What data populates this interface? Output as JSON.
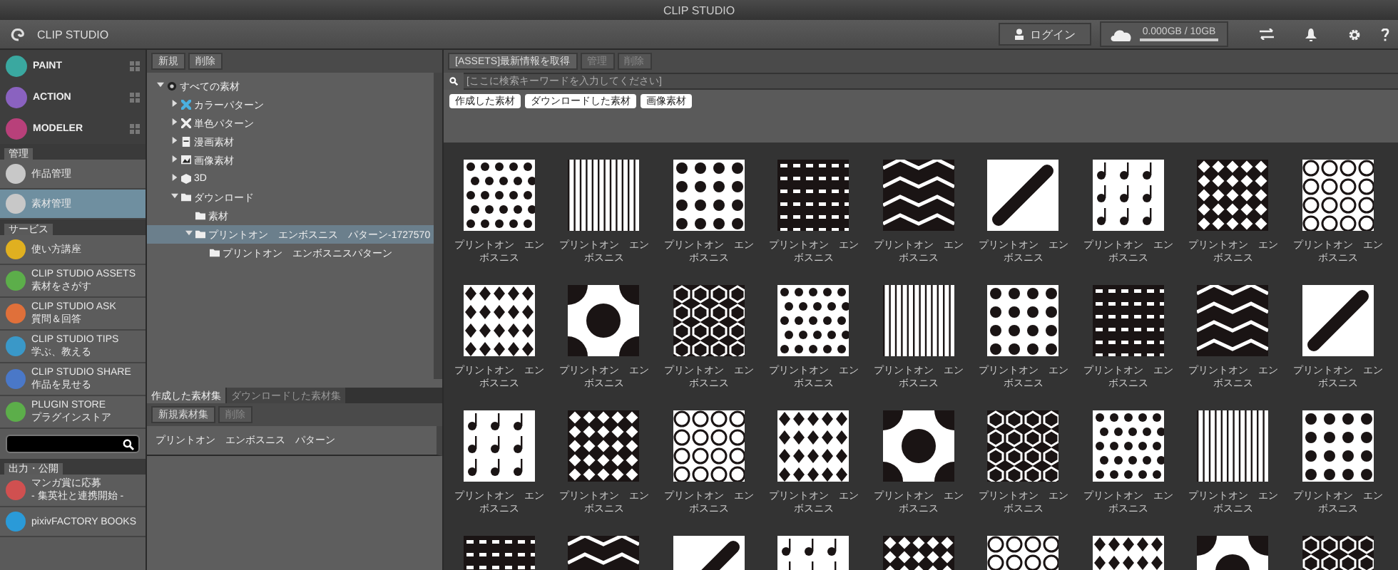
{
  "window": {
    "title": "CLIP STUDIO"
  },
  "header": {
    "app_name": "CLIP STUDIO",
    "login": "ログイン",
    "storage": {
      "reading": "0.000GB / 10GB",
      "level": 0
    }
  },
  "sidebar": {
    "apps": [
      {
        "label": "PAINT",
        "color": "#3aa8a0"
      },
      {
        "label": "ACTION",
        "color": "#8a62c0"
      },
      {
        "label": "MODELER",
        "color": "#b8407a"
      }
    ],
    "sections": [
      {
        "title": "管理",
        "items": [
          {
            "label": "作品管理",
            "selected": false,
            "color": "#c8c8c8"
          },
          {
            "label": "素材管理",
            "selected": true,
            "color": "#c8c8c8"
          }
        ]
      },
      {
        "title": "サービス",
        "items": [
          {
            "label": "使い方講座",
            "selected": false,
            "color": "#e0b020"
          },
          {
            "label": "CLIP STUDIO ASSETS",
            "sub": "素材をさがす",
            "selected": false,
            "color": "#5cae4a"
          },
          {
            "label": "CLIP STUDIO ASK",
            "sub": "質問＆回答",
            "selected": false,
            "color": "#e0703a"
          },
          {
            "label": "CLIP STUDIO TIPS",
            "sub": "学ぶ、教える",
            "selected": false,
            "color": "#3a98c8"
          },
          {
            "label": "CLIP STUDIO SHARE",
            "sub": "作品を見せる",
            "selected": false,
            "color": "#4a78c8"
          },
          {
            "label": "PLUGIN STORE",
            "sub": "プラグインストア",
            "selected": false,
            "color": "#5cae4a"
          }
        ]
      },
      {
        "title": "出力・公開",
        "search": true,
        "items": [
          {
            "label": "マンガ賞に応募",
            "sub": "- 集英社と連携開始 -",
            "selected": false,
            "color": "#d05050"
          },
          {
            "label": "pixivFACTORY BOOKS",
            "selected": false,
            "color": "#2a9ad8"
          }
        ]
      }
    ]
  },
  "tree": {
    "buttons": [
      {
        "label": "新規",
        "disabled": false
      },
      {
        "label": "削除",
        "disabled": false
      }
    ],
    "items": [
      {
        "label": "すべての素材",
        "kind": "root",
        "expanded": true,
        "selected": false,
        "children": [
          {
            "label": "カラーパターン",
            "kind": "color",
            "expanded": false,
            "selected": false
          },
          {
            "label": "単色パターン",
            "kind": "mono",
            "expanded": false,
            "selected": false
          },
          {
            "label": "漫画素材",
            "kind": "manga",
            "expanded": false,
            "selected": false
          },
          {
            "label": "画像素材",
            "kind": "image",
            "expanded": false,
            "selected": false
          },
          {
            "label": "3D",
            "kind": "cube",
            "expanded": false,
            "selected": false
          },
          {
            "label": "ダウンロード",
            "kind": "folder",
            "expanded": true,
            "selected": false,
            "children": [
              {
                "label": "素材",
                "kind": "folder",
                "selected": false
              },
              {
                "label": "プリントオン　エンボスニス　パターン-1727570",
                "kind": "folder",
                "expanded": true,
                "selected": true,
                "children": [
                  {
                    "label": "プリントオン　エンボスニスパターン",
                    "kind": "folder",
                    "selected": false
                  }
                ]
              }
            ]
          }
        ]
      }
    ]
  },
  "collections": {
    "tabs": [
      {
        "label": "作成した素材集",
        "selected": true
      },
      {
        "label": "ダウンロードした素材集",
        "selected": false
      }
    ],
    "buttons": [
      {
        "label": "新規素材集",
        "disabled": false
      },
      {
        "label": "削除",
        "disabled": true
      }
    ],
    "items": [
      {
        "label": "プリントオン　エンボスニス　パターン",
        "selected": false
      }
    ]
  },
  "main": {
    "buttons": [
      {
        "label": "[ASSETS]最新情報を取得",
        "disabled": false
      },
      {
        "label": "管理",
        "disabled": true
      },
      {
        "label": "削除",
        "disabled": true
      }
    ],
    "search": {
      "placeholder": "[ここに検索キーワードを入力してください]"
    },
    "filters": [
      "作成した素材",
      "ダウンロードした素材",
      "画像素材"
    ],
    "tiles": [
      {
        "kind": "labeled",
        "label": "プリントオン　エンボスニス"
      },
      {
        "kind": "labeled",
        "label": "プリントオン　エンボスニス"
      },
      {
        "kind": "labeled",
        "label": "プリントオン　エンボスニス"
      },
      {
        "kind": "labeled",
        "label": "プリントオン　エンボスニス"
      },
      {
        "kind": "labeled",
        "label": "プリントオン　エンボスニス"
      },
      {
        "kind": "labeled",
        "label": "プリントオン　エンボスニス"
      },
      {
        "kind": "labeled",
        "label": "プリントオン　エンボスニス"
      },
      {
        "kind": "labeled",
        "label": "プリントオン　エンボスニス"
      },
      {
        "kind": "labeled",
        "label": "プリントオン　エンボスニス"
      },
      {
        "kind": "labeled",
        "label": "プリントオン　エンボスニス"
      },
      {
        "kind": "labeled",
        "label": "プリントオン　エンボスニス"
      },
      {
        "kind": "labeled",
        "label": "プリントオン　エンボスニス"
      },
      {
        "kind": "labeled",
        "label": "プリントオン　エンボスニス"
      },
      {
        "kind": "labeled",
        "label": "プリントオン　エンボスニス"
      },
      {
        "kind": "labeled",
        "label": "プリントオン　エンボスニス"
      },
      {
        "kind": "labeled",
        "label": "プリントオン　エンボスニス"
      },
      {
        "kind": "labeled",
        "label": "プリントオン　エンボスニス"
      },
      {
        "kind": "labeled",
        "label": "プリントオン　エンボスニス"
      },
      {
        "kind": "labeled",
        "label": "プリントオン　エンボスニス"
      },
      {
        "kind": "labeled",
        "label": "プリントオン　エンボスニス"
      },
      {
        "kind": "labeled",
        "label": "プリントオン　エンボスニス"
      },
      {
        "kind": "labeled",
        "label": "プリントオン　エンボスニス"
      },
      {
        "kind": "labeled",
        "label": "プリントオン　エンボスニス"
      },
      {
        "kind": "labeled",
        "label": "プリントオン　エンボスニス"
      },
      {
        "kind": "labeled",
        "label": "プリントオン　エンボスニス"
      },
      {
        "kind": "labeled",
        "label": "プリントオン　エンボスニス"
      },
      {
        "kind": "labeled",
        "label": "プリントオン　エンボスニス"
      },
      {
        "kind": "cut"
      },
      {
        "kind": "cut"
      },
      {
        "kind": "cut"
      },
      {
        "kind": "cut"
      },
      {
        "kind": "cut"
      },
      {
        "kind": "cut"
      },
      {
        "kind": "cut"
      },
      {
        "kind": "cut"
      },
      {
        "kind": "cut"
      }
    ]
  }
}
